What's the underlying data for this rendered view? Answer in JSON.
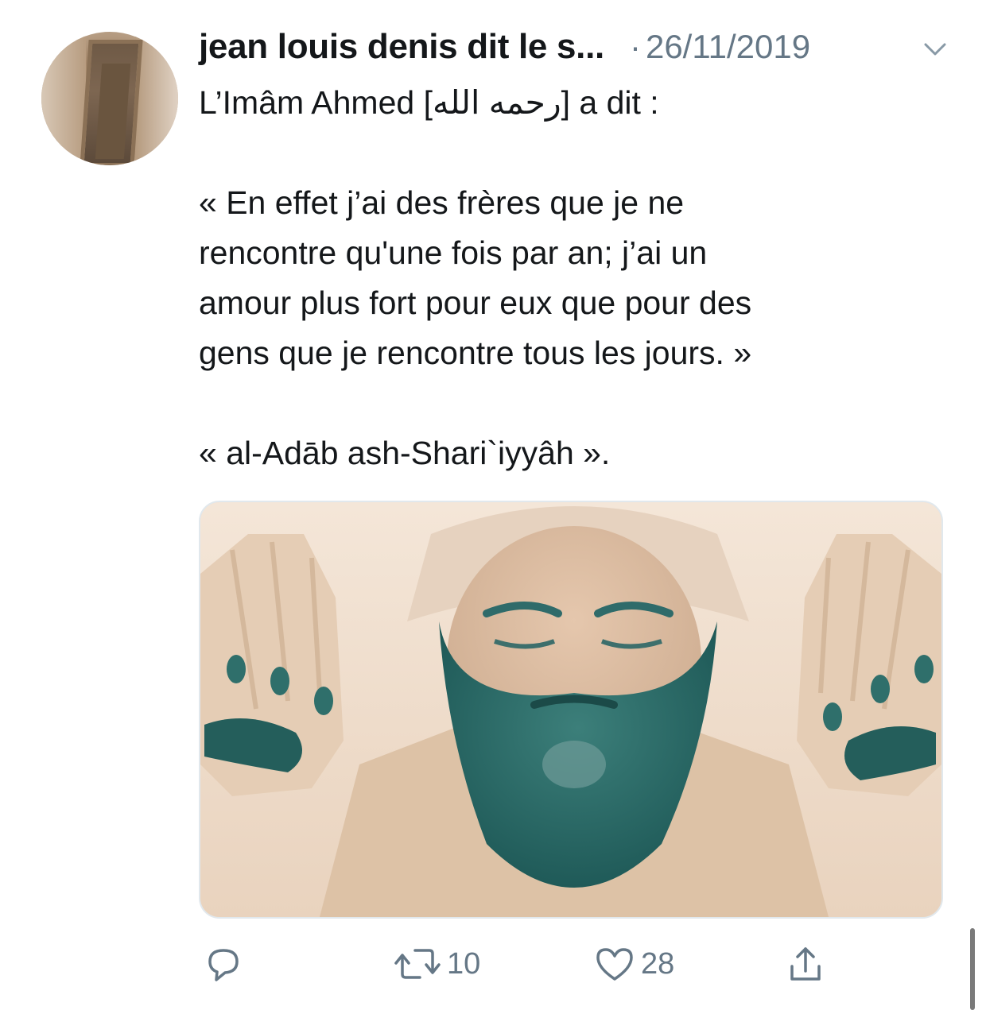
{
  "tweet": {
    "display_name": "jean louis denis dit le s...",
    "separator": "·",
    "date": "26/11/2019",
    "lines": [
      "L’Imâm Ahmed [رحمه الله] a dit :",
      "",
      "« En effet j’ai des frères que je ne",
      "rencontre qu'une fois par an; j’ai un",
      "amour plus fort pour eux que pour des",
      "gens que je rencontre tous les jours. »",
      "",
      "« al-Adāb ash-Shari`iyyâh »."
    ],
    "icons": {
      "avatar": "grave-photo-avatar",
      "menu": "chevron-down-icon",
      "reply": "reply-icon",
      "retweet": "retweet-icon",
      "like": "heart-icon",
      "share": "share-icon"
    },
    "actions": {
      "reply_count": "",
      "retweet_count": "10",
      "like_count": "28"
    }
  },
  "colors": {
    "text": "#14171a",
    "secondary": "#657786",
    "border": "#e1e8ed",
    "background": "#ffffff"
  }
}
